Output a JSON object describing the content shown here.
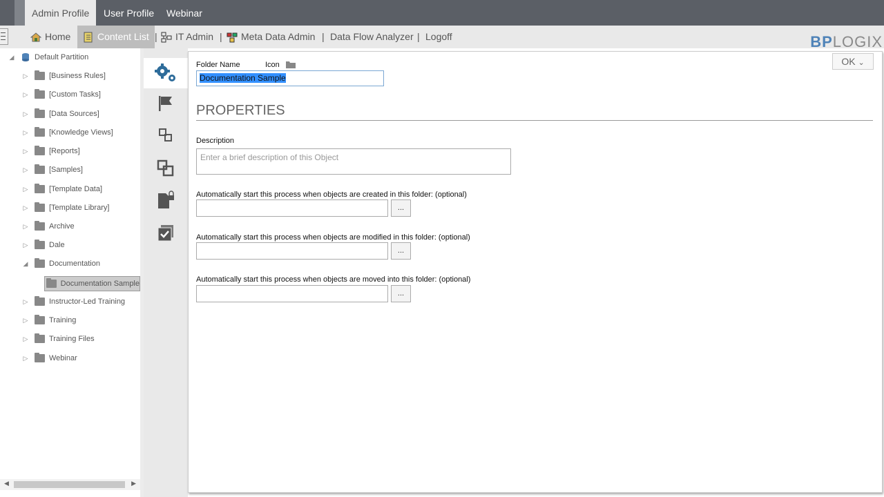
{
  "profile_tabs": [
    "Admin Profile",
    "User Profile",
    "Webinar"
  ],
  "nav": {
    "home": "Home",
    "content_list": "Content List",
    "it_admin": "IT Admin",
    "meta_data_admin": "Meta Data Admin",
    "data_flow_analyzer": "Data Flow Analyzer",
    "logoff": "Logoff",
    "separator": "|"
  },
  "logo": {
    "part1": "BP",
    "part2": "LOGIX"
  },
  "tree": {
    "root": "Default Partition",
    "items": [
      "[Business Rules]",
      "[Custom Tasks]",
      "[Data Sources]",
      "[Knowledge Views]",
      "[Reports]",
      "[Samples]",
      "[Template Data]",
      "[Template Library]",
      "Archive",
      "Dale",
      "Documentation",
      "Documentation Sample",
      "Instructor-Led Training",
      "Training",
      "Training Files",
      "Webinar"
    ],
    "selected": "Documentation Sample"
  },
  "side_icons": [
    "gears-icon",
    "flag-icon",
    "connect-icon",
    "copy-icon",
    "secure-file-icon",
    "checklist-icon"
  ],
  "form": {
    "ok_label": "OK",
    "folder_name_label": "Folder Name",
    "icon_label": "Icon",
    "folder_name_value": "Documentation Sample",
    "properties_heading": "PROPERTIES",
    "description_label": "Description",
    "description_placeholder": "Enter a brief description of this Object",
    "created_label": "Automatically start this process when objects are created in this folder: (optional)",
    "modified_label": "Automatically start this process when objects are modified in this folder: (optional)",
    "moved_label": "Automatically start this process when objects are moved into this folder: (optional)",
    "browse_label": "..."
  },
  "colors": {
    "accent": "#4f83b8",
    "topbar": "#5b5f66",
    "navbar": "#e9e9e9"
  }
}
